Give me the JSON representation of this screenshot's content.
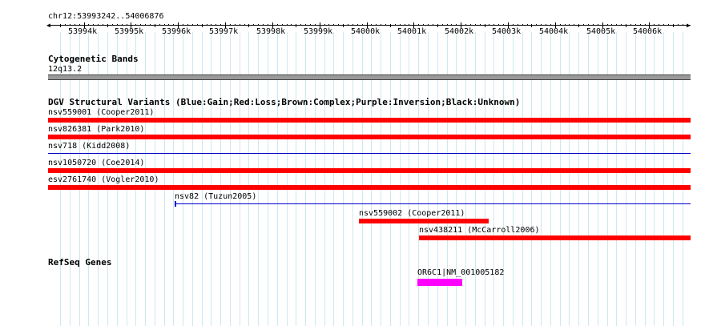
{
  "region": {
    "label": "chr12:53993242..54006876",
    "start": 53993242,
    "end": 54006876
  },
  "ruler": {
    "ticks": [
      {
        "label": "53994k",
        "pos": 53994000
      },
      {
        "label": "53995k",
        "pos": 53995000
      },
      {
        "label": "53996k",
        "pos": 53996000
      },
      {
        "label": "53997k",
        "pos": 53997000
      },
      {
        "label": "53998k",
        "pos": 53998000
      },
      {
        "label": "53999k",
        "pos": 53999000
      },
      {
        "label": "54000k",
        "pos": 54000000
      },
      {
        "label": "54001k",
        "pos": 54001000
      },
      {
        "label": "54002k",
        "pos": 54002000
      },
      {
        "label": "54003k",
        "pos": 54003000
      },
      {
        "label": "54004k",
        "pos": 54004000
      },
      {
        "label": "54005k",
        "pos": 54005000
      },
      {
        "label": "54006k",
        "pos": 54006000
      }
    ]
  },
  "cytoband": {
    "title": "Cytogenetic Bands",
    "band_label": "12q13.2",
    "color": "#9a9a9a"
  },
  "dgv": {
    "title": "DGV Structural Variants (Blue:Gain;Red:Loss;Brown:Complex;Purple:Inversion;Black:Unknown)",
    "colors": {
      "loss": "#ff0000",
      "gain": "#0000cc"
    },
    "variants": [
      {
        "label": "nsv559001 (Cooper2011)",
        "type": "loss",
        "start": 53993242,
        "end": 54006876
      },
      {
        "label": "nsv826381 (Park2010)",
        "type": "loss",
        "start": 53993242,
        "end": 54006876
      },
      {
        "label": "nsv718 (Kidd2008)",
        "type": "gain",
        "start": 53993242,
        "end": 54006876
      },
      {
        "label": "nsv1050720 (Coe2014)",
        "type": "loss",
        "start": 53993242,
        "end": 54006876
      },
      {
        "label": "esv2761740 (Vogler2010)",
        "type": "loss",
        "start": 53993242,
        "end": 54006876
      },
      {
        "label": "nsv82 (Tuzun2005)",
        "type": "gain",
        "start": 53995930,
        "end": 54006876,
        "start_tick": true
      },
      {
        "label": "nsv559002 (Cooper2011)",
        "type": "loss",
        "start": 53999840,
        "end": 54002600
      },
      {
        "label": "nsv438211 (McCarroll2006)",
        "type": "loss",
        "start": 54001110,
        "end": 54006876
      }
    ]
  },
  "refseq": {
    "title": "RefSeq Genes",
    "color": "#ff00ff",
    "genes": [
      {
        "label": "OR6C1|NM_001005182",
        "start": 54001080,
        "end": 54002030
      }
    ]
  }
}
